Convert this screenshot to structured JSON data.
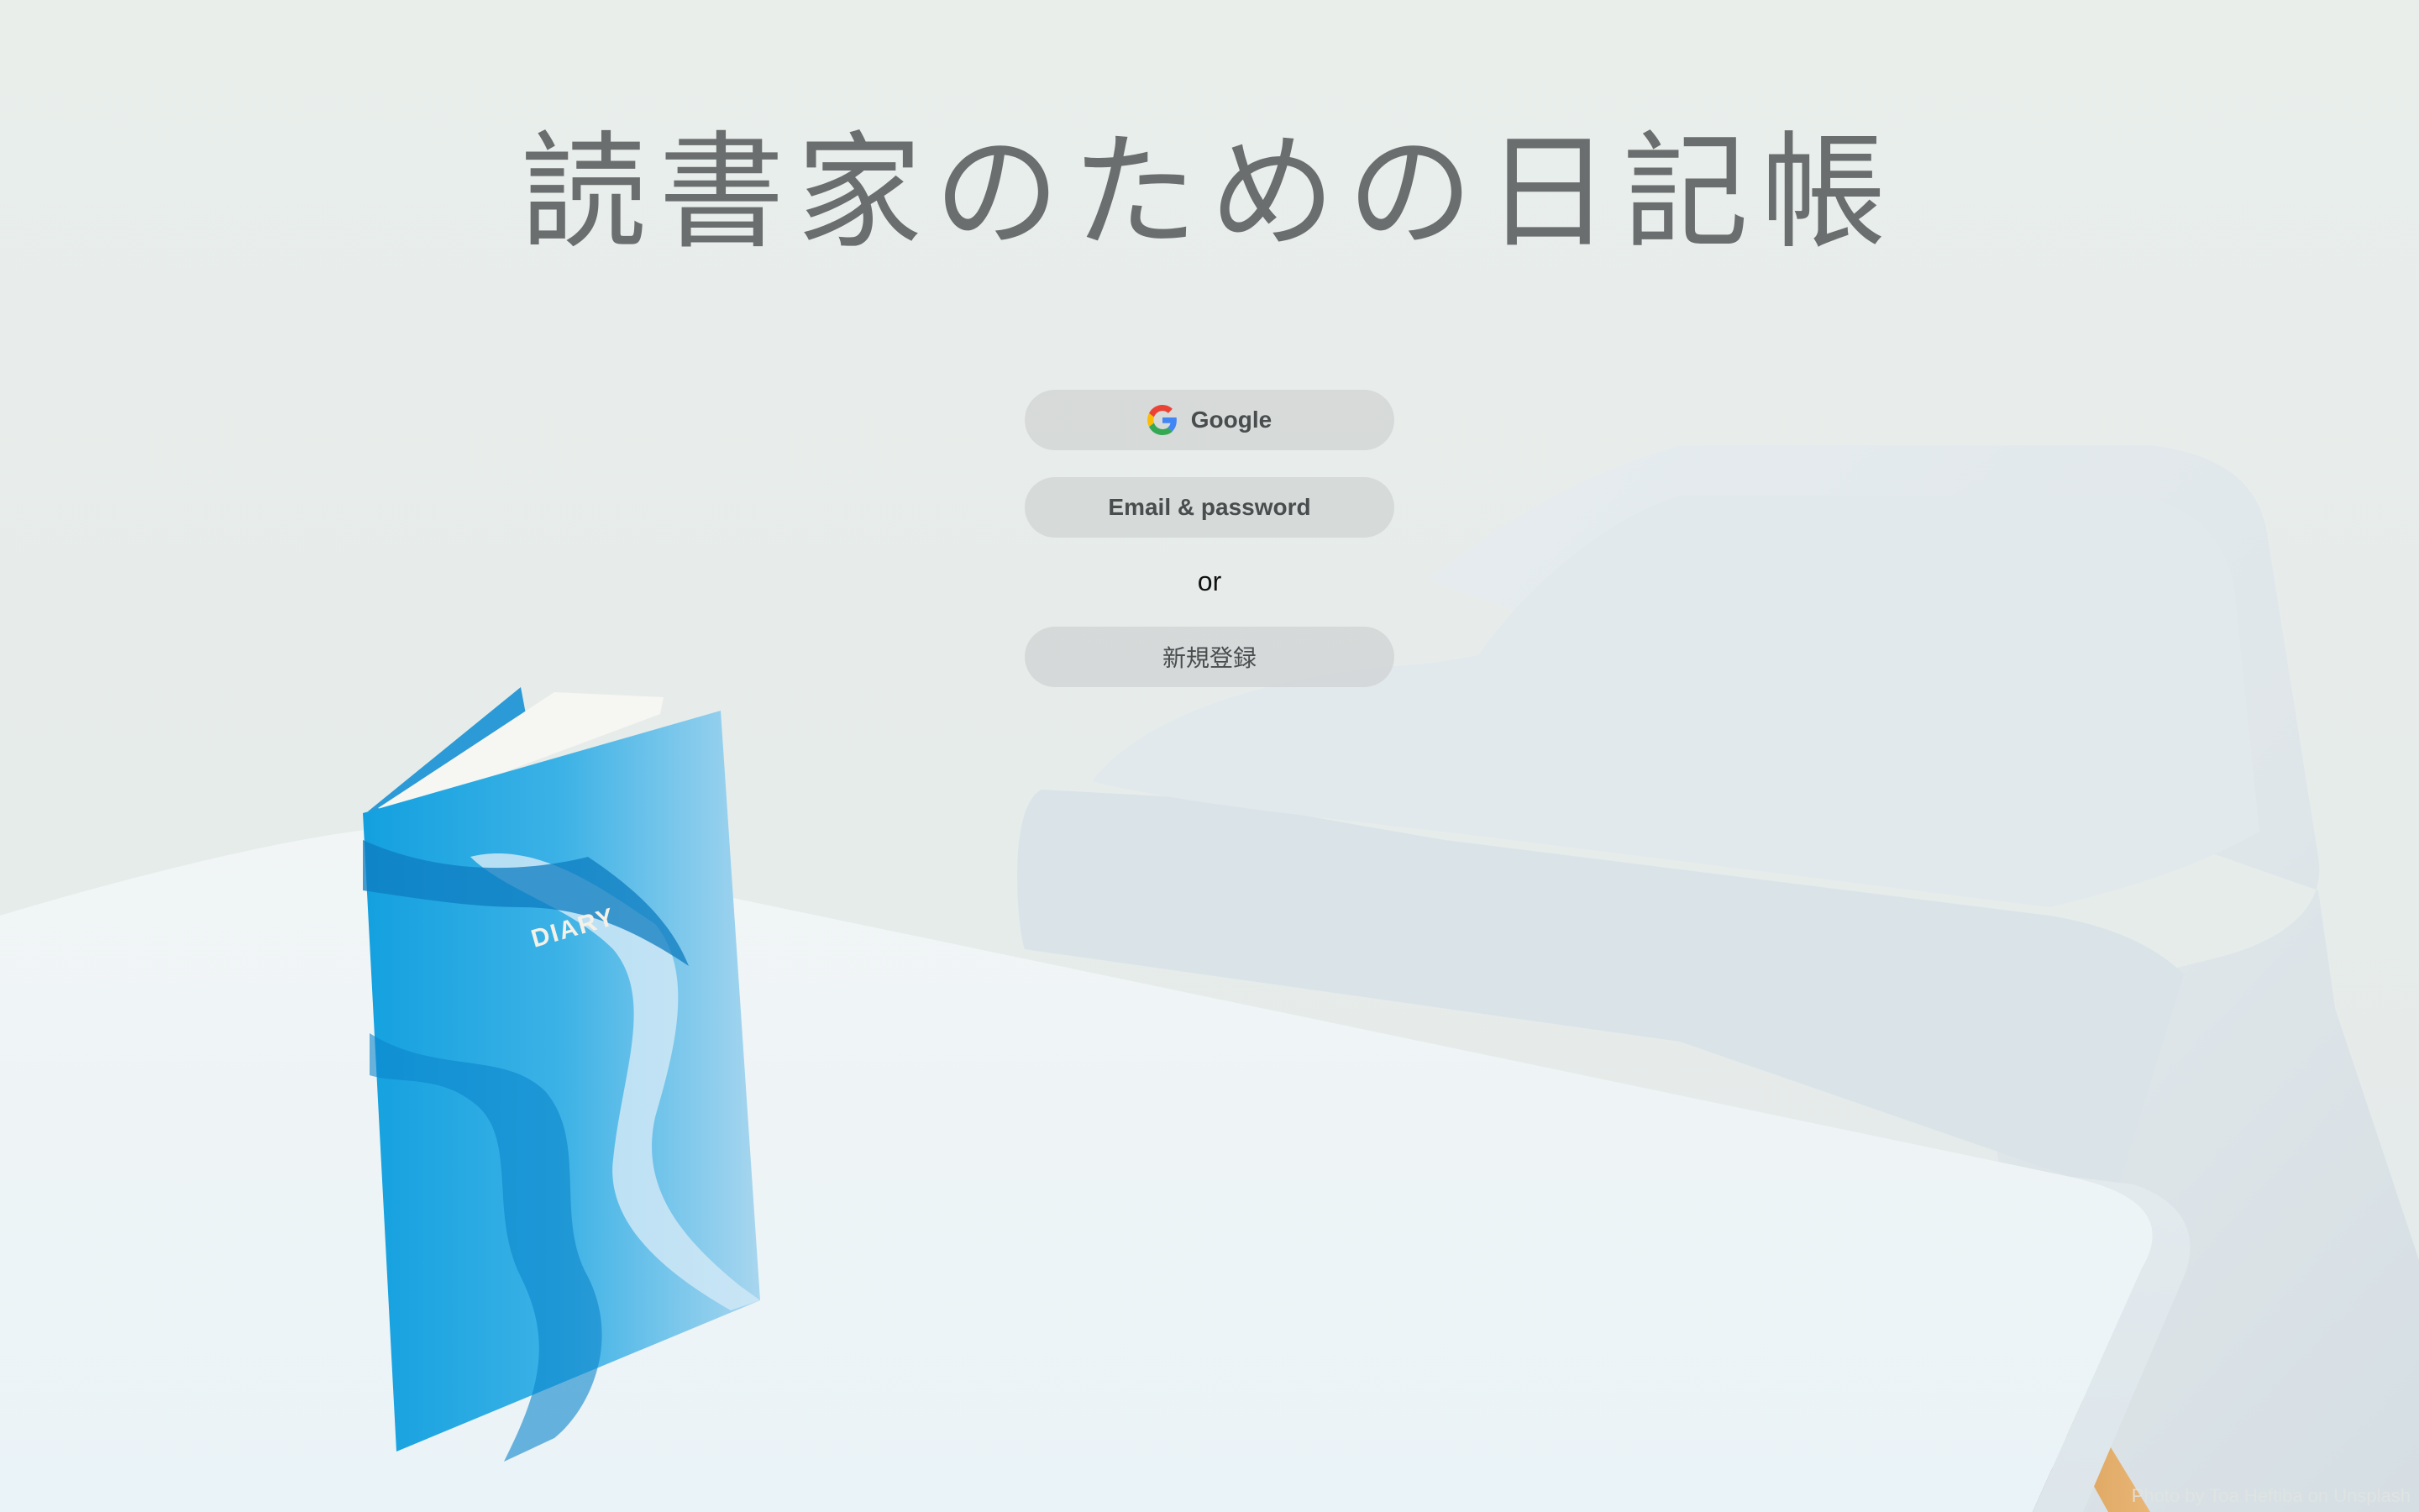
{
  "header": {
    "title": "読書家のための日記帳"
  },
  "auth": {
    "google_label": "Google",
    "email_label": "Email & password",
    "separator": "or",
    "signup_label": "新規登録"
  },
  "background": {
    "book_cover_text": "DIARY",
    "photo_credit": "Photo by Toa Heftiba on Unsplash"
  },
  "colors": {
    "title": "#6b6e6e",
    "button_bg": "#cbcecd",
    "button_text": "#4a4d4d",
    "book_blue": "#1aa3de"
  },
  "icons": {
    "google": "google-g-icon"
  }
}
